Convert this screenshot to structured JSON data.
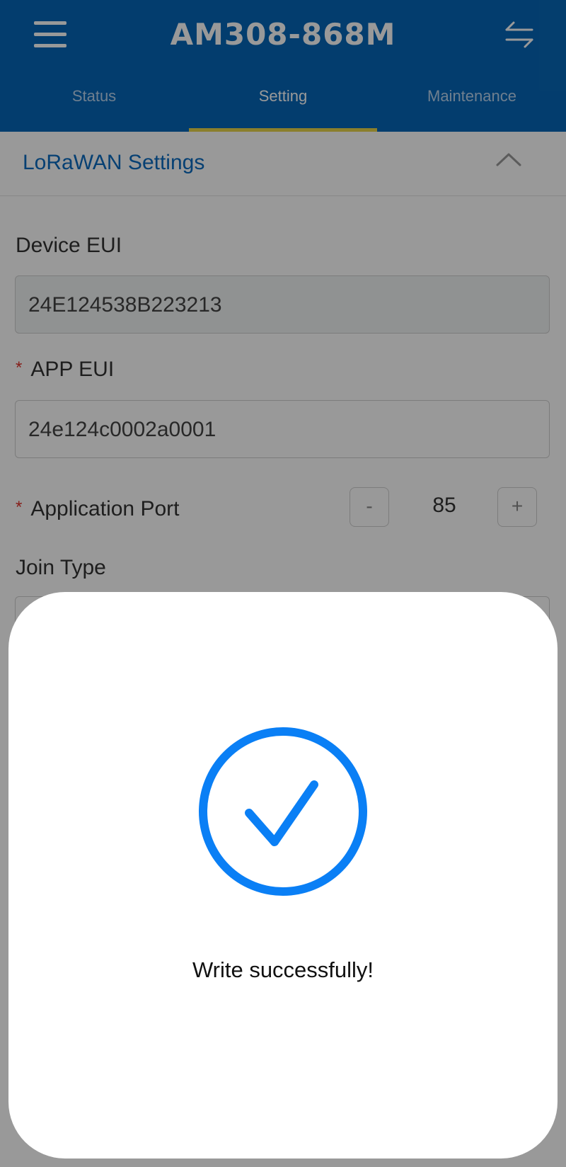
{
  "header": {
    "title": "AM308-868M",
    "menu_icon": "hamburger-menu-icon",
    "switch_icon": "swap-arrows-icon",
    "tabs": [
      {
        "label": "Status",
        "active": false
      },
      {
        "label": "Setting",
        "active": true
      },
      {
        "label": "Maintenance",
        "active": false
      }
    ]
  },
  "section": {
    "title": "LoRaWAN Settings",
    "collapse_icon": "chevron-up-icon"
  },
  "fields": {
    "device_eui": {
      "label": "Device EUI",
      "value": "24E124538B223213"
    },
    "app_eui": {
      "required_mark": "*",
      "label": "APP EUI",
      "value": "24e124c0002a0001"
    },
    "application_port": {
      "required_mark": "*",
      "label": "Application Port",
      "value": "85",
      "decrement": "-",
      "increment": "+"
    },
    "join_type": {
      "label": "Join Type"
    }
  },
  "modal": {
    "icon": "checkmark-circle-icon",
    "message": "Write successfully!"
  },
  "colors": {
    "header_bg": "#0667b8",
    "tab_indicator": "#e8d44a",
    "section_title": "#0a6bc0",
    "required": "#e0322b",
    "success": "#0a7ff5"
  }
}
